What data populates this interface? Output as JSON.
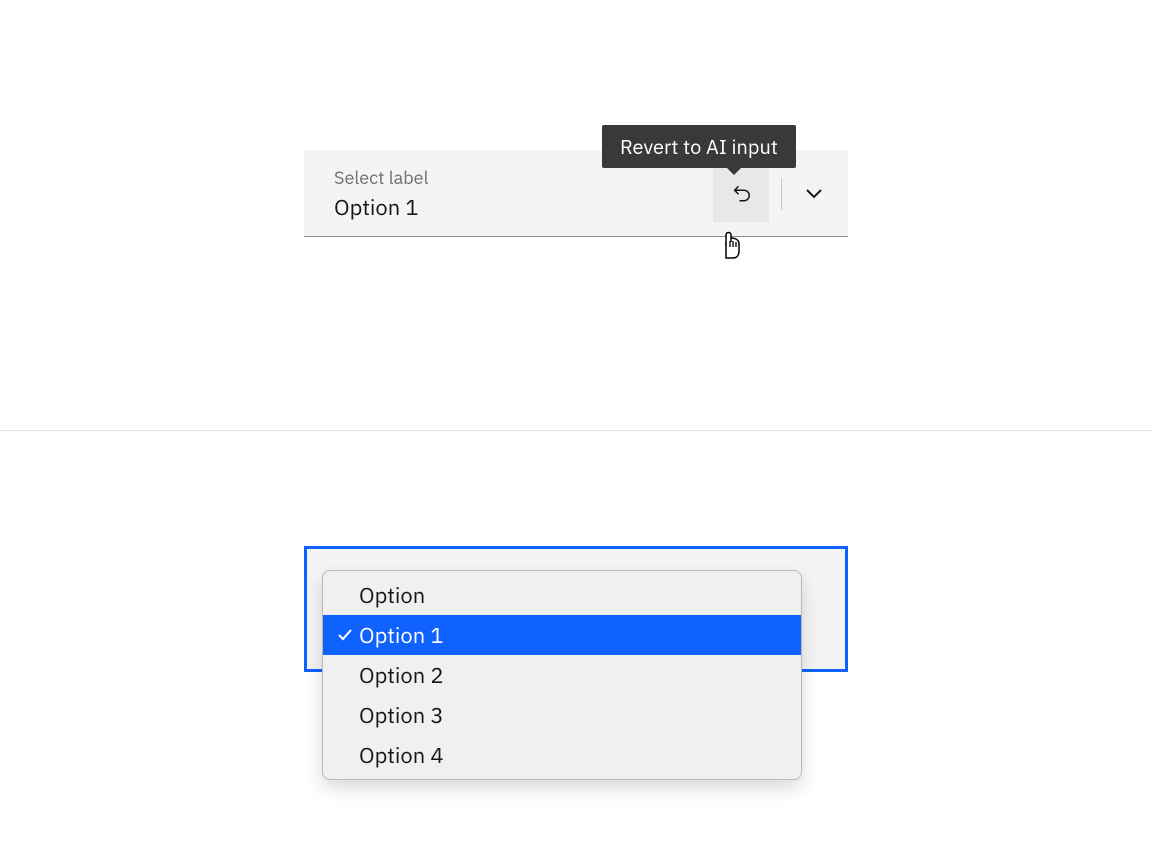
{
  "dropdown": {
    "label": "Select label",
    "value": "Option 1",
    "revert_tooltip": "Revert to AI input"
  },
  "options_list": {
    "items": [
      {
        "label": "Option",
        "selected": false
      },
      {
        "label": "Option 1",
        "selected": true
      },
      {
        "label": "Option 2",
        "selected": false
      },
      {
        "label": "Option 3",
        "selected": false
      },
      {
        "label": "Option 4",
        "selected": false
      }
    ]
  },
  "colors": {
    "focus": "#0f62fe",
    "tooltip_bg": "#393939"
  }
}
